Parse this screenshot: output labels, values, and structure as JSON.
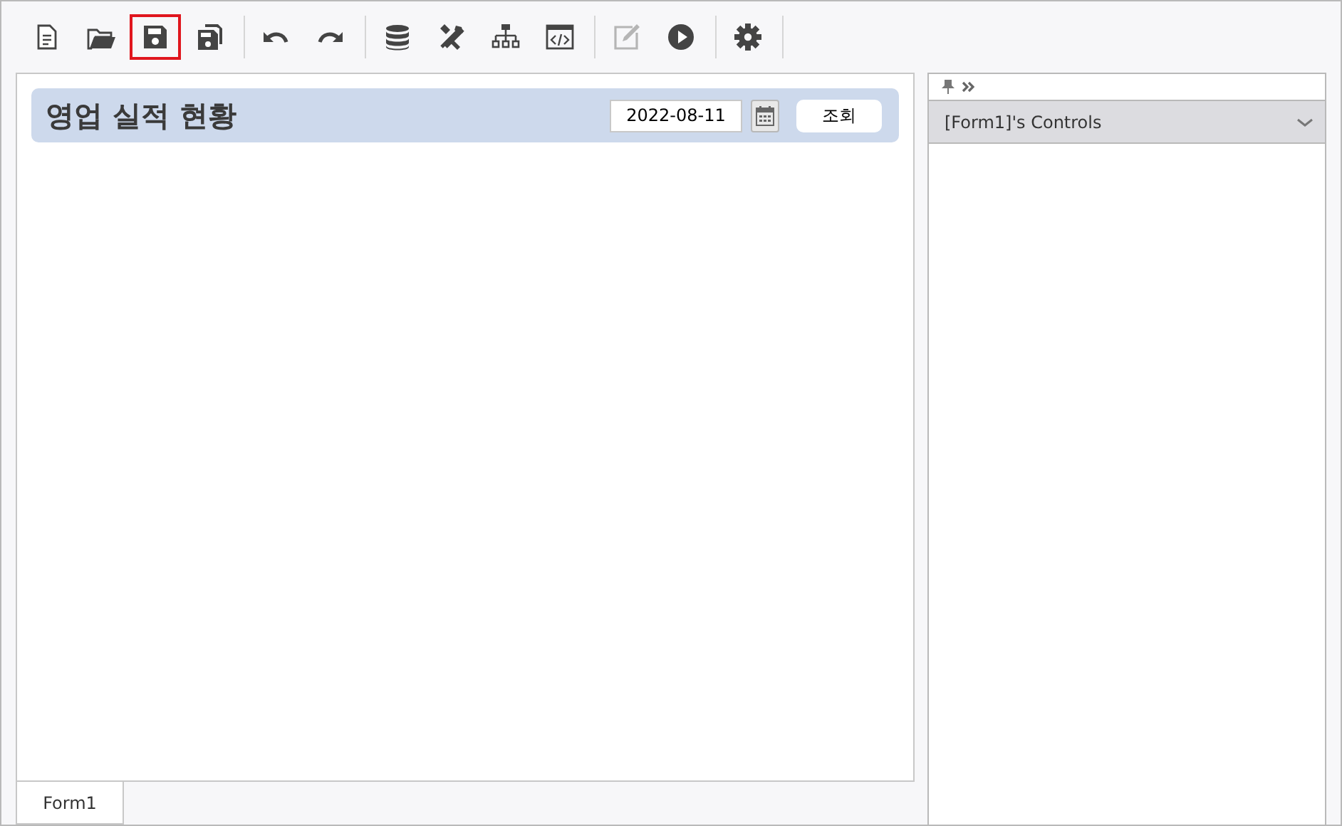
{
  "toolbar": [
    [
      {
        "selected": false,
        "disabled": false
      },
      {
        "selected": false,
        "disabled": false
      },
      {
        "selected": true,
        "disabled": false
      },
      {
        "selected": false,
        "disabled": false
      }
    ],
    [
      {
        "selected": false,
        "disabled": false
      },
      {
        "selected": false,
        "disabled": false
      }
    ],
    [
      {
        "selected": false,
        "disabled": false
      },
      {
        "selected": false,
        "disabled": false
      },
      {
        "selected": false,
        "disabled": false
      },
      {
        "selected": false,
        "disabled": false
      }
    ],
    [
      {
        "selected": false,
        "disabled": true
      },
      {
        "selected": false,
        "disabled": false
      }
    ],
    [
      {
        "selected": false,
        "disabled": false
      }
    ]
  ],
  "form": {
    "title": "영업 실적 현황",
    "date": "2022-08-11",
    "search_button": "조회"
  },
  "tabs": [
    {
      "label": "Form1",
      "selected": true
    }
  ],
  "controls_panel": {
    "header": "[Form1]'s Controls",
    "expanded": true
  }
}
